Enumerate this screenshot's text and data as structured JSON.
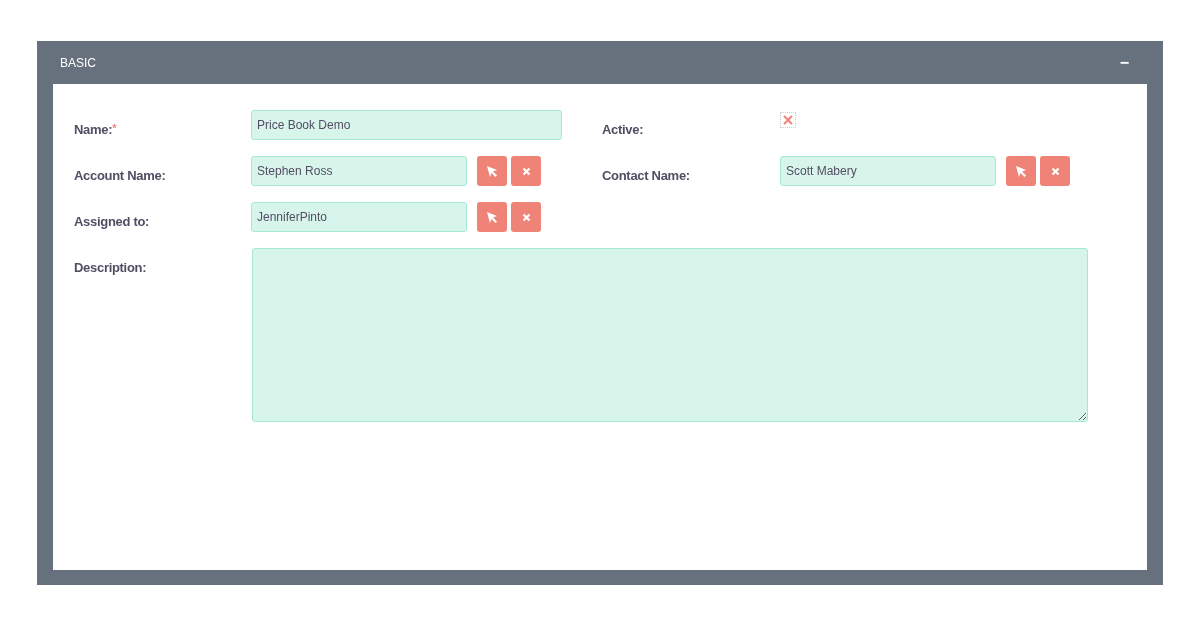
{
  "panel": {
    "title": "BASIC",
    "collapse_icon": "−"
  },
  "fields": [
    {
      "kind": "text",
      "label": "Name:",
      "required_mark": "*",
      "value": "Price Book Demo"
    },
    {
      "kind": "checkbox",
      "label": "Active:",
      "checked": true
    },
    {
      "kind": "relate",
      "label": "Account Name:",
      "value": "Stephen Ross"
    },
    {
      "kind": "relate",
      "label": "Contact Name:",
      "value": "Scott Mabery"
    },
    {
      "kind": "relate",
      "label": "Assigned to:",
      "value": "JenniferPinto"
    },
    {
      "kind": "textarea",
      "label": "Description:"
    }
  ]
}
